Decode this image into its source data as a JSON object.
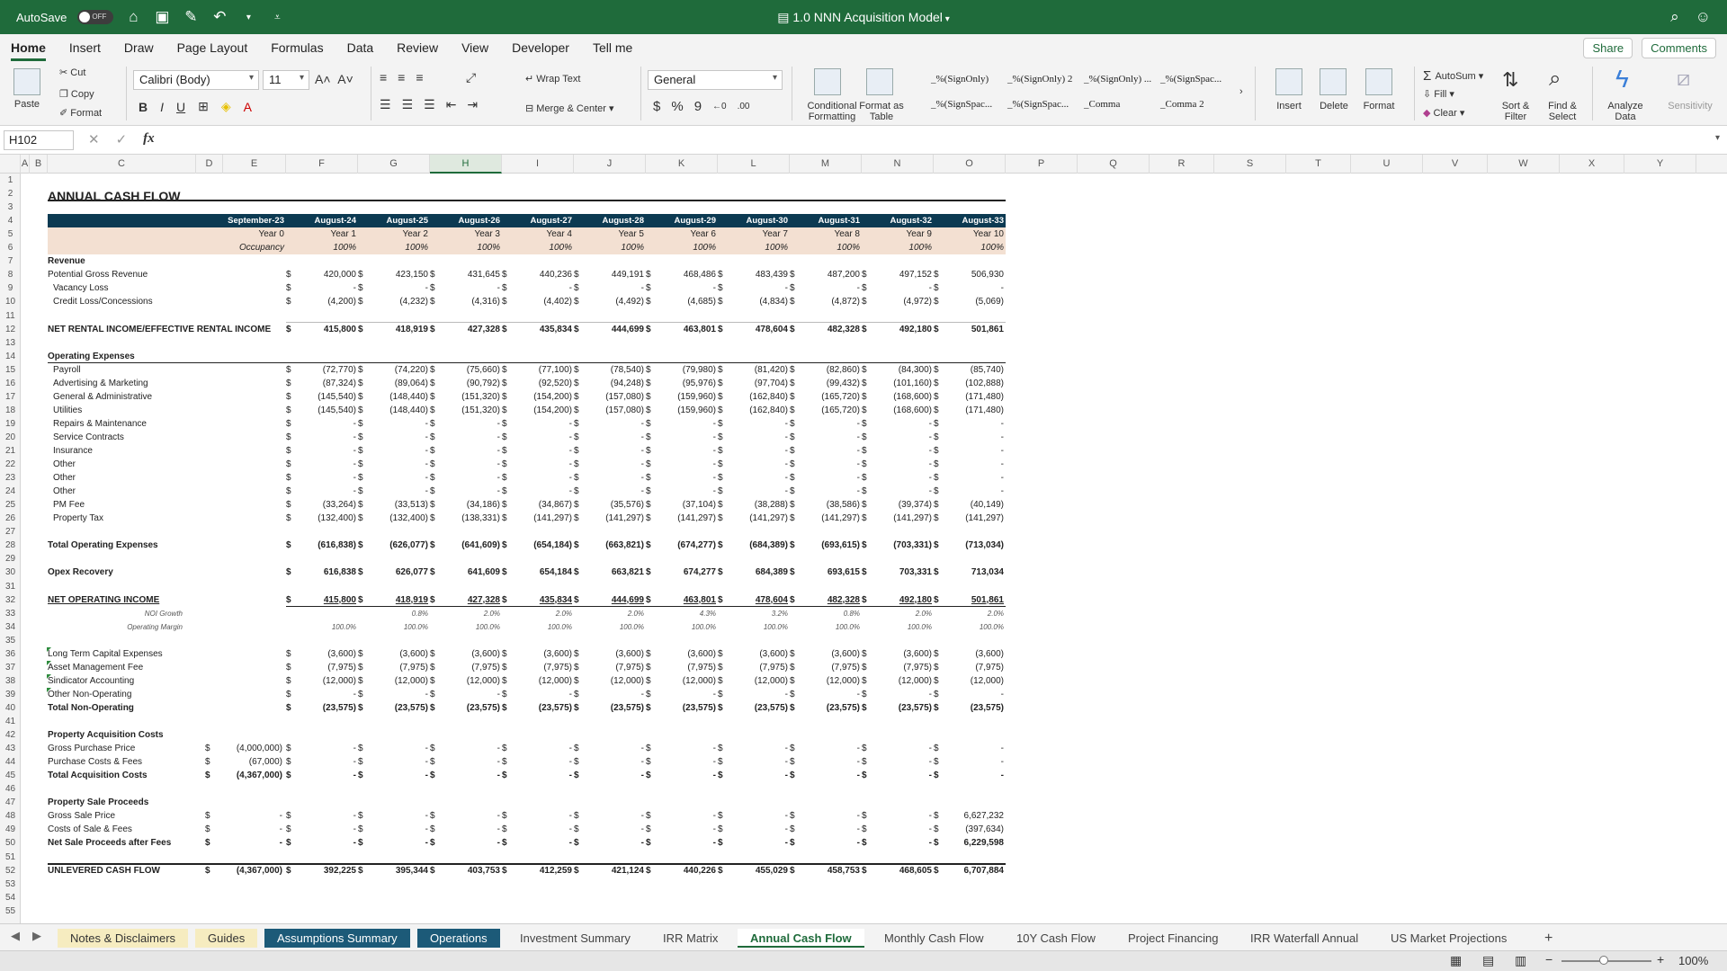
{
  "app": {
    "autosave": "AutoSave",
    "autosave_state": "OFF",
    "title": "1.0 NNN Acquisition Model"
  },
  "ribbon_tabs": [
    "Home",
    "Insert",
    "Draw",
    "Page Layout",
    "Formulas",
    "Data",
    "Review",
    "View",
    "Developer",
    "Tell me"
  ],
  "share_label": "Share",
  "comments_label": "Comments",
  "ribbon": {
    "paste": "Paste",
    "cut": "Cut",
    "copy": "Copy",
    "format": "Format",
    "font": "Calibri (Body)",
    "size": "11",
    "wrap": "Wrap Text",
    "merge": "Merge & Center",
    "numfmt": "General",
    "cond": "Conditional Formatting",
    "fmt_table": "Format as Table",
    "insert": "Insert",
    "delete": "Delete",
    "format2": "Format",
    "autosum": "AutoSum",
    "fill": "Fill",
    "clear": "Clear",
    "sort": "Sort & Filter",
    "find": "Find & Select",
    "analyze": "Analyze Data",
    "sensitivity": "Sensitivity",
    "styles": [
      "_%(SignOnly)",
      "_%(SignOnly) 2",
      "_%(SignOnly) ...",
      "_%(SignSpac...",
      "_%(SignSpac...",
      "_%(SignSpac...",
      "_Comma",
      "_Comma 2"
    ]
  },
  "namebox": "H102",
  "columns": [
    "A",
    "B",
    "C",
    "D",
    "E",
    "F",
    "G",
    "H",
    "I",
    "J",
    "K",
    "L",
    "M",
    "N",
    "O",
    "P",
    "Q",
    "R",
    "S",
    "T",
    "U",
    "V",
    "W",
    "X",
    "Y"
  ],
  "selected_col": "H",
  "sheet": {
    "title": "ANNUAL CASH FLOW",
    "dates": [
      "September-23",
      "August-24",
      "August-25",
      "August-26",
      "August-27",
      "August-28",
      "August-29",
      "August-30",
      "August-31",
      "August-32",
      "August-33"
    ],
    "years": [
      "Year 0",
      "Year 1",
      "Year 2",
      "Year 3",
      "Year 4",
      "Year 5",
      "Year 6",
      "Year 7",
      "Year 8",
      "Year 9",
      "Year 10"
    ],
    "occupancy_label": "Occupancy",
    "occupancy": [
      "100%",
      "100%",
      "100%",
      "100%",
      "100%",
      "100%",
      "100%",
      "100%",
      "100%",
      "100%"
    ],
    "rows": [
      {
        "r": 7,
        "label": "Revenue",
        "b": true
      },
      {
        "r": 8,
        "label": "Potential Gross Revenue",
        "vals": [
          "420,000",
          "423,150",
          "431,645",
          "440,236",
          "449,191",
          "468,486",
          "483,439",
          "487,200",
          "497,152",
          "506,930"
        ]
      },
      {
        "r": 9,
        "label": "Vacancy Loss",
        "ind": 1,
        "vals": [
          "-",
          "-",
          "-",
          "-",
          "-",
          "-",
          "-",
          "-",
          "-",
          "-"
        ]
      },
      {
        "r": 10,
        "label": "Credit Loss/Concessions",
        "ind": 1,
        "vals": [
          "(4,200)",
          "(4,232)",
          "(4,316)",
          "(4,402)",
          "(4,492)",
          "(4,685)",
          "(4,834)",
          "(4,872)",
          "(4,972)",
          "(5,069)"
        ]
      },
      {
        "r": 12,
        "label": "NET RENTAL INCOME/EFFECTIVE RENTAL INCOME",
        "b": true,
        "vals": [
          "415,800",
          "418,919",
          "427,328",
          "435,834",
          "444,699",
          "463,801",
          "478,604",
          "482,328",
          "492,180",
          "501,861"
        ]
      },
      {
        "r": 14,
        "label": "Operating Expenses",
        "b": true,
        "line": true
      },
      {
        "r": 15,
        "label": "Payroll",
        "ind": 1,
        "vals": [
          "(72,770)",
          "(74,220)",
          "(75,660)",
          "(77,100)",
          "(78,540)",
          "(79,980)",
          "(81,420)",
          "(82,860)",
          "(84,300)",
          "(85,740)"
        ]
      },
      {
        "r": 16,
        "label": "Advertising & Marketing",
        "ind": 1,
        "vals": [
          "(87,324)",
          "(89,064)",
          "(90,792)",
          "(92,520)",
          "(94,248)",
          "(95,976)",
          "(97,704)",
          "(99,432)",
          "(101,160)",
          "(102,888)"
        ]
      },
      {
        "r": 17,
        "label": "General & Administrative",
        "ind": 1,
        "vals": [
          "(145,540)",
          "(148,440)",
          "(151,320)",
          "(154,200)",
          "(157,080)",
          "(159,960)",
          "(162,840)",
          "(165,720)",
          "(168,600)",
          "(171,480)"
        ]
      },
      {
        "r": 18,
        "label": "Utilities",
        "ind": 1,
        "vals": [
          "(145,540)",
          "(148,440)",
          "(151,320)",
          "(154,200)",
          "(157,080)",
          "(159,960)",
          "(162,840)",
          "(165,720)",
          "(168,600)",
          "(171,480)"
        ]
      },
      {
        "r": 19,
        "label": "Repairs & Maintenance",
        "ind": 1,
        "vals": [
          "-",
          "-",
          "-",
          "-",
          "-",
          "-",
          "-",
          "-",
          "-",
          "-"
        ]
      },
      {
        "r": 20,
        "label": "Service Contracts",
        "ind": 1,
        "vals": [
          "-",
          "-",
          "-",
          "-",
          "-",
          "-",
          "-",
          "-",
          "-",
          "-"
        ]
      },
      {
        "r": 21,
        "label": "Insurance",
        "ind": 1,
        "vals": [
          "-",
          "-",
          "-",
          "-",
          "-",
          "-",
          "-",
          "-",
          "-",
          "-"
        ]
      },
      {
        "r": 22,
        "label": "Other",
        "ind": 1,
        "vals": [
          "-",
          "-",
          "-",
          "-",
          "-",
          "-",
          "-",
          "-",
          "-",
          "-"
        ]
      },
      {
        "r": 23,
        "label": "Other",
        "ind": 1,
        "vals": [
          "-",
          "-",
          "-",
          "-",
          "-",
          "-",
          "-",
          "-",
          "-",
          "-"
        ]
      },
      {
        "r": 24,
        "label": "Other",
        "ind": 1,
        "vals": [
          "-",
          "-",
          "-",
          "-",
          "-",
          "-",
          "-",
          "-",
          "-",
          "-"
        ]
      },
      {
        "r": 25,
        "label": "PM Fee",
        "ind": 1,
        "vals": [
          "(33,264)",
          "(33,513)",
          "(34,186)",
          "(34,867)",
          "(35,576)",
          "(37,104)",
          "(38,288)",
          "(38,586)",
          "(39,374)",
          "(40,149)"
        ]
      },
      {
        "r": 26,
        "label": "Property Tax",
        "ind": 1,
        "vals": [
          "(132,400)",
          "(132,400)",
          "(138,331)",
          "(141,297)",
          "(141,297)",
          "(141,297)",
          "(141,297)",
          "(141,297)",
          "(141,297)",
          "(141,297)"
        ]
      },
      {
        "r": 28,
        "label": "Total Operating Expenses",
        "b": true,
        "vals": [
          "(616,838)",
          "(626,077)",
          "(641,609)",
          "(654,184)",
          "(663,821)",
          "(674,277)",
          "(684,389)",
          "(693,615)",
          "(703,331)",
          "(713,034)"
        ]
      },
      {
        "r": 30,
        "label": "Opex Recovery",
        "b": true,
        "vals": [
          "616,838",
          "626,077",
          "641,609",
          "654,184",
          "663,821",
          "674,277",
          "684,389",
          "693,615",
          "703,331",
          "713,034"
        ]
      },
      {
        "r": 32,
        "label": "NET OPERATING INCOME",
        "b": true,
        "u": true,
        "vals": [
          "415,800",
          "418,919",
          "427,328",
          "435,834",
          "444,699",
          "463,801",
          "478,604",
          "482,328",
          "492,180",
          "501,861"
        ]
      },
      {
        "r": 33,
        "label": "NOI Growth",
        "sub": true,
        "pct": [
          "",
          "0.8%",
          "2.0%",
          "2.0%",
          "2.0%",
          "4.3%",
          "3.2%",
          "0.8%",
          "2.0%",
          "2.0%"
        ]
      },
      {
        "r": 34,
        "label": "Operating Margin",
        "sub": true,
        "pct": [
          "100.0%",
          "100.0%",
          "100.0%",
          "100.0%",
          "100.0%",
          "100.0%",
          "100.0%",
          "100.0%",
          "100.0%",
          "100.0%"
        ]
      },
      {
        "r": 36,
        "label": "Long Term Capital Expenses",
        "tri": true,
        "vals": [
          "(3,600)",
          "(3,600)",
          "(3,600)",
          "(3,600)",
          "(3,600)",
          "(3,600)",
          "(3,600)",
          "(3,600)",
          "(3,600)",
          "(3,600)"
        ]
      },
      {
        "r": 37,
        "label": "Asset Management Fee",
        "tri": true,
        "vals": [
          "(7,975)",
          "(7,975)",
          "(7,975)",
          "(7,975)",
          "(7,975)",
          "(7,975)",
          "(7,975)",
          "(7,975)",
          "(7,975)",
          "(7,975)"
        ]
      },
      {
        "r": 38,
        "label": "Sindicator Accounting",
        "tri": true,
        "vals": [
          "(12,000)",
          "(12,000)",
          "(12,000)",
          "(12,000)",
          "(12,000)",
          "(12,000)",
          "(12,000)",
          "(12,000)",
          "(12,000)",
          "(12,000)"
        ]
      },
      {
        "r": 39,
        "label": "Other Non-Operating",
        "tri": true,
        "vals": [
          "-",
          "-",
          "-",
          "-",
          "-",
          "-",
          "-",
          "-",
          "-",
          "-"
        ]
      },
      {
        "r": 40,
        "label": "Total Non-Operating",
        "b": true,
        "vals": [
          "(23,575)",
          "(23,575)",
          "(23,575)",
          "(23,575)",
          "(23,575)",
          "(23,575)",
          "(23,575)",
          "(23,575)",
          "(23,575)",
          "(23,575)"
        ]
      },
      {
        "r": 42,
        "label": "Property Acquisition Costs",
        "b": true
      },
      {
        "r": 43,
        "label": "Gross Purchase Price",
        "y0": "(4,000,000)",
        "vals": [
          "-",
          "-",
          "-",
          "-",
          "-",
          "-",
          "-",
          "-",
          "-",
          "-"
        ]
      },
      {
        "r": 44,
        "label": "Purchase Costs & Fees",
        "y0": "(67,000)",
        "vals": [
          "-",
          "-",
          "-",
          "-",
          "-",
          "-",
          "-",
          "-",
          "-",
          "-"
        ]
      },
      {
        "r": 45,
        "label": "Total Acquisition Costs",
        "b": true,
        "y0": "(4,367,000)",
        "vals": [
          "-",
          "-",
          "-",
          "-",
          "-",
          "-",
          "-",
          "-",
          "-",
          "-"
        ]
      },
      {
        "r": 47,
        "label": "Property Sale Proceeds",
        "b": true
      },
      {
        "r": 48,
        "label": "Gross Sale Price",
        "y0": "-",
        "vals": [
          "-",
          "-",
          "-",
          "-",
          "-",
          "-",
          "-",
          "-",
          "-",
          "6,627,232"
        ]
      },
      {
        "r": 49,
        "label": "Costs of Sale & Fees",
        "y0": "-",
        "vals": [
          "-",
          "-",
          "-",
          "-",
          "-",
          "-",
          "-",
          "-",
          "-",
          "(397,634)"
        ]
      },
      {
        "r": 50,
        "label": "Net Sale Proceeds after Fees",
        "b": true,
        "y0": "-",
        "vals": [
          "-",
          "-",
          "-",
          "-",
          "-",
          "-",
          "-",
          "-",
          "-",
          "6,229,598"
        ]
      },
      {
        "r": 52,
        "label": "UNLEVERED CASH FLOW",
        "b": true,
        "y0": "(4,367,000)",
        "vals": [
          "392,225",
          "395,344",
          "403,753",
          "412,259",
          "421,124",
          "440,226",
          "455,029",
          "458,753",
          "468,605",
          "6,707,884"
        ]
      }
    ]
  },
  "sheet_tabs": [
    {
      "n": "Notes & Disclaimers",
      "c": "y"
    },
    {
      "n": "Guides",
      "c": "y"
    },
    {
      "n": "Assumptions Summary",
      "c": "t"
    },
    {
      "n": "Operations",
      "c": "t"
    },
    {
      "n": "Investment Summary",
      "c": ""
    },
    {
      "n": "IRR Matrix",
      "c": ""
    },
    {
      "n": "Annual Cash Flow",
      "c": "act"
    },
    {
      "n": "Monthly Cash Flow",
      "c": ""
    },
    {
      "n": "10Y Cash Flow",
      "c": ""
    },
    {
      "n": "Project Financing",
      "c": ""
    },
    {
      "n": "IRR Waterfall Annual",
      "c": ""
    },
    {
      "n": "US Market Projections",
      "c": ""
    }
  ],
  "add_sheet": "+",
  "zoom": "100%"
}
